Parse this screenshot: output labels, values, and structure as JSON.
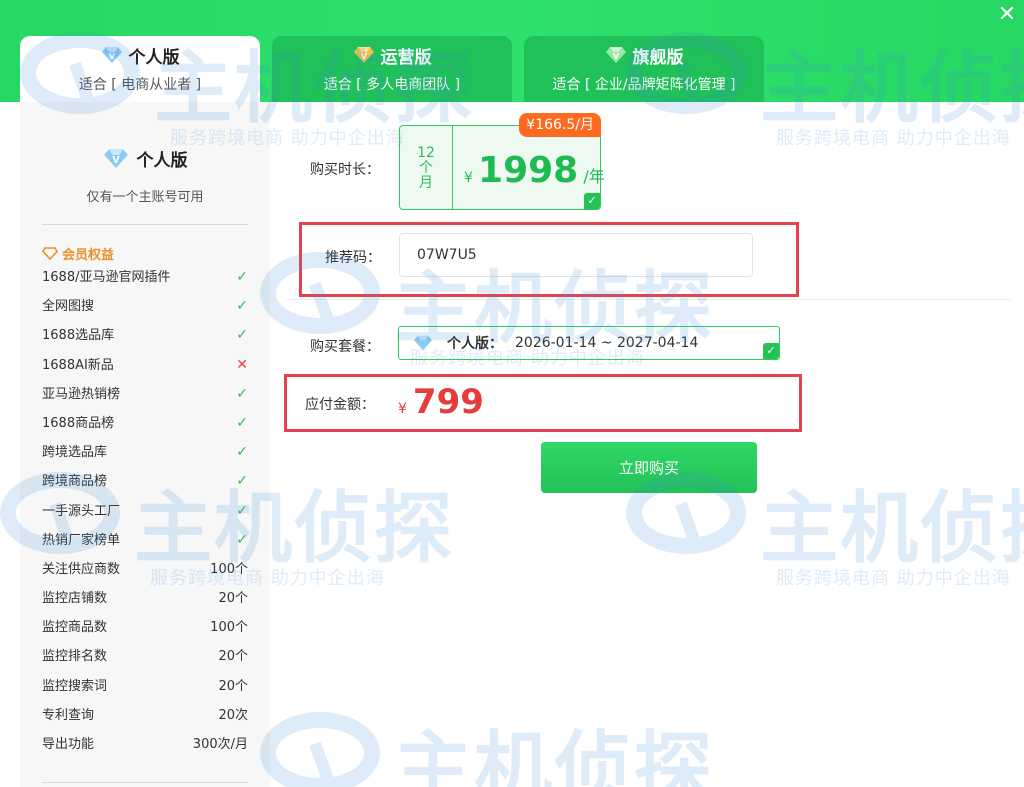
{
  "window": {
    "close_symbol": "✕"
  },
  "tabs": [
    {
      "title": "个人版",
      "subtitle": "适合 [ 电商从业者 ]",
      "active": true
    },
    {
      "title": "运营版",
      "subtitle": "适合 [ 多人电商团队 ]",
      "active": false
    },
    {
      "title": "旗舰版",
      "subtitle": "适合 [ 企业/品牌矩阵化管理 ]",
      "active": false
    }
  ],
  "sidebar": {
    "title": "个人版",
    "subtitle": "仅有一个主账号可用",
    "benefits_title": "会员权益",
    "benefits": [
      {
        "name": "1688/亚马逊官网插件",
        "value": "✓"
      },
      {
        "name": "全网图搜",
        "value": "✓"
      },
      {
        "name": "1688选品库",
        "value": "✓"
      },
      {
        "name": "1688AI新品",
        "value": "✕"
      },
      {
        "name": "亚马逊热销榜",
        "value": "✓"
      },
      {
        "name": "1688商品榜",
        "value": "✓"
      },
      {
        "name": "跨境选品库",
        "value": "✓"
      },
      {
        "name": "跨境商品榜",
        "value": "✓"
      },
      {
        "name": "一手源头工厂",
        "value": "✓"
      },
      {
        "name": "热销厂家榜单",
        "value": "✓"
      },
      {
        "name": "关注供应商数",
        "value": "100个"
      },
      {
        "name": "监控店铺数",
        "value": "20个"
      },
      {
        "name": "监控商品数",
        "value": "100个"
      },
      {
        "name": "监控排名数",
        "value": "20个"
      },
      {
        "name": "监控搜索词",
        "value": "20个"
      },
      {
        "name": "专利查询",
        "value": "20次"
      },
      {
        "name": "导出功能",
        "value": "300次/月"
      }
    ]
  },
  "form": {
    "duration_label": "购买时长：",
    "duration": {
      "months_number": "12",
      "months_unit_1": "个",
      "months_unit_2": "月",
      "currency": "¥",
      "price": "1998",
      "per": "/年",
      "monthly_badge": "¥166.5/月",
      "selected_mark": "✓"
    },
    "referral_label": "推荐码：",
    "referral_value": "07W7U5",
    "package_label": "购买套餐：",
    "package": {
      "name": "个人版：",
      "range": "2026-01-14 ~ 2027-04-14",
      "selected_mark": "✓"
    },
    "amount_label": "应付金额：",
    "amount_currency": "¥",
    "amount_value": "799",
    "buy_button": "立即购买"
  },
  "watermark": {
    "brand": "主机侦探",
    "slogan": "服务跨境电商 助力中企出海"
  },
  "colors": {
    "brand_green": "#2ddc68",
    "price_green": "#1fbb52",
    "price_red": "#e83c3c",
    "badge_orange": "#ff6a1f",
    "highlight_red": "#e6424d",
    "benefit_gold": "#e8912a"
  }
}
